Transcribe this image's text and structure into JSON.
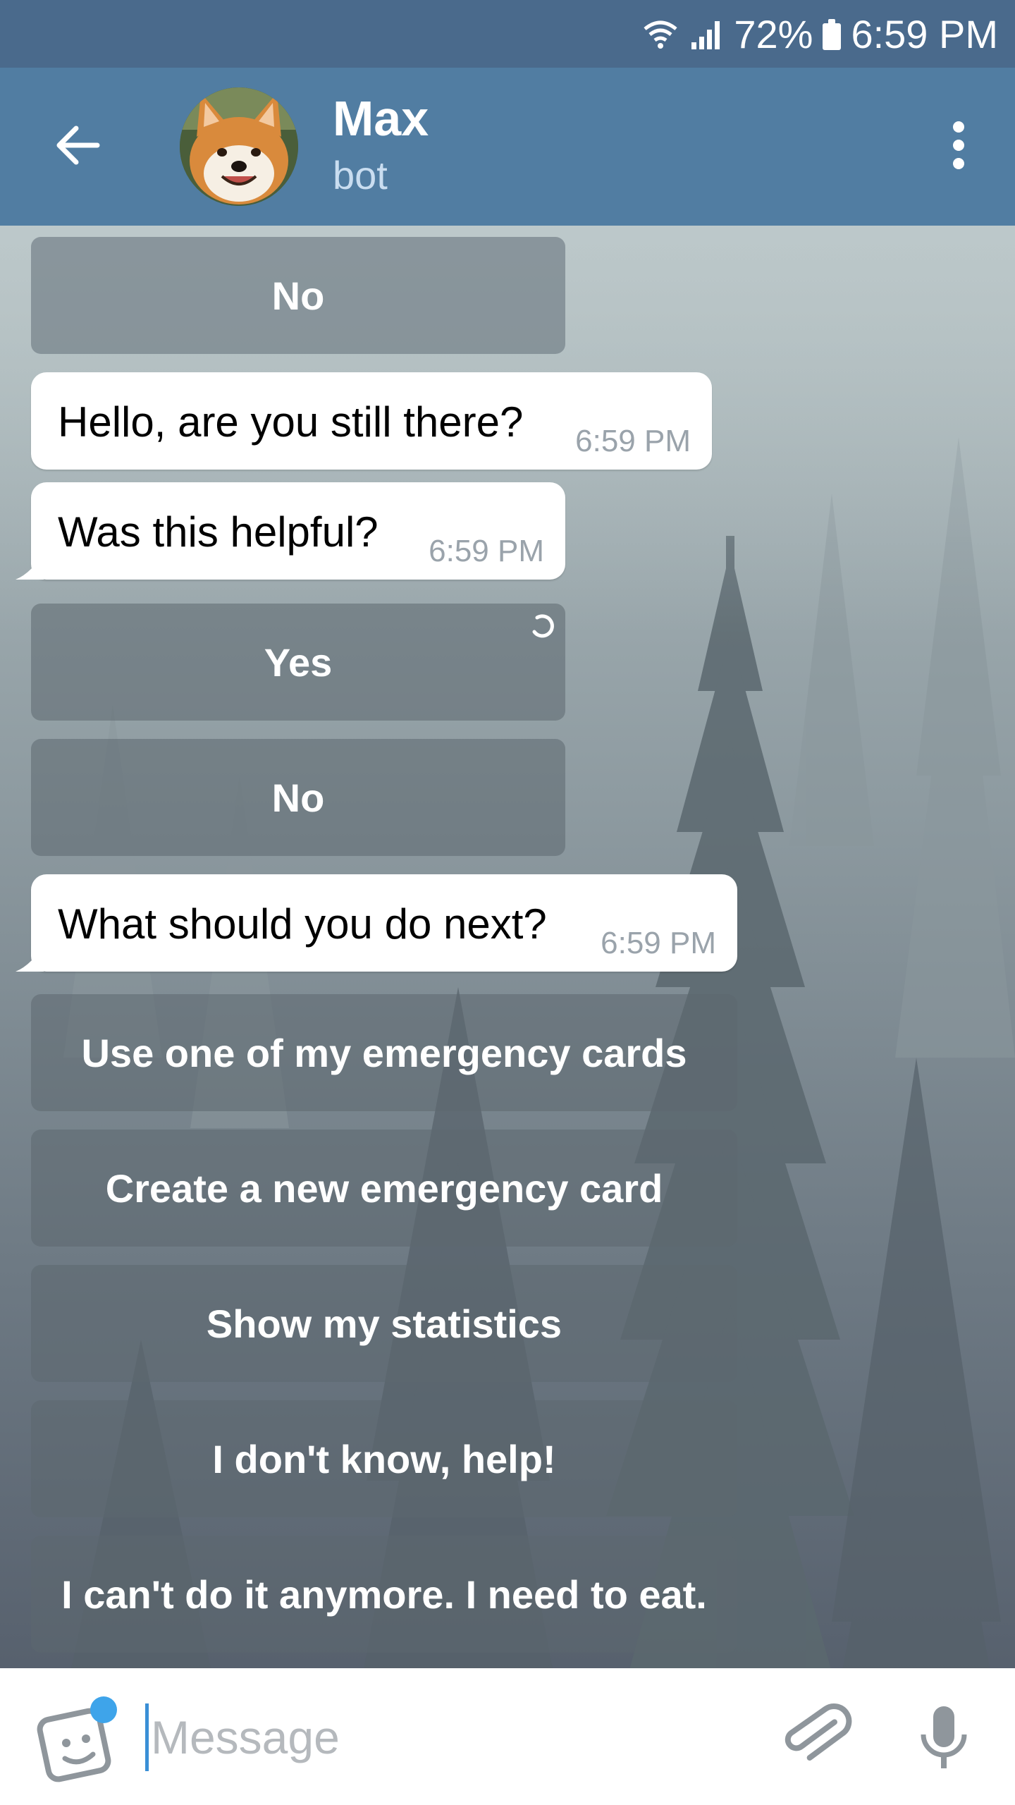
{
  "status_bar": {
    "battery": "72%",
    "time": "6:59 PM"
  },
  "header": {
    "title": "Max",
    "subtitle": "bot"
  },
  "messages": [
    {
      "type": "button",
      "label": "No"
    },
    {
      "type": "bubble",
      "text": "Hello, are you still there?",
      "time": "6:59 PM"
    },
    {
      "type": "bubble",
      "text": "Was this helpful?",
      "time": "6:59 PM"
    },
    {
      "type": "button",
      "label": "Yes"
    },
    {
      "type": "button",
      "label": "No"
    },
    {
      "type": "bubble",
      "text": "What should you do next?",
      "time": "6:59 PM"
    },
    {
      "type": "button",
      "label": "Use one of my emergency cards"
    },
    {
      "type": "button",
      "label": "Create a new emergency card"
    },
    {
      "type": "button",
      "label": "Show my statistics"
    },
    {
      "type": "button",
      "label": "I don't know, help!"
    },
    {
      "type": "button",
      "label": "I can't do it anymore. I need to eat."
    }
  ],
  "input": {
    "placeholder": "Message"
  },
  "colors": {
    "status_bar": "#4a6a8c",
    "app_bar": "#517da2",
    "accent": "#3ea4ea"
  },
  "icons": [
    "wifi-icon",
    "signal-icon",
    "battery-icon",
    "back-arrow-icon",
    "more-vert-icon",
    "sticker-icon",
    "paperclip-icon",
    "microphone-icon",
    "loading-spinner-icon"
  ]
}
